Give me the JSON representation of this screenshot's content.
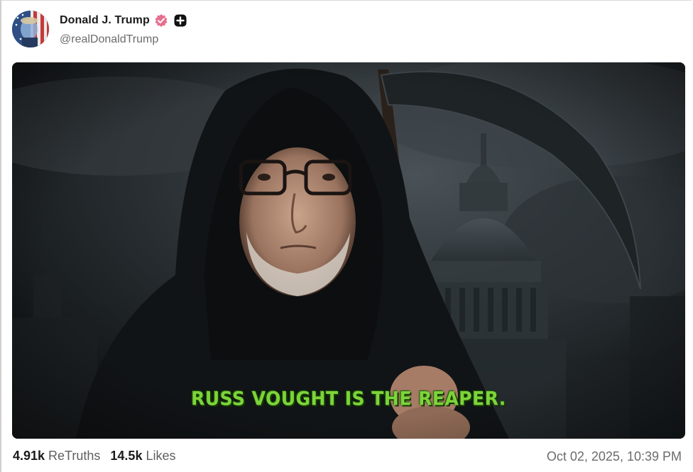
{
  "post": {
    "author_name": "Donald J. Trump",
    "handle": "@realDonaldTrump",
    "verified_color": "#e86f8f",
    "media_caption": "RUSS VOUGHT IS THE REAPER.",
    "caption_color": "#7dd43a",
    "retruths_count": "4.91k",
    "retruths_label": "ReTruths",
    "likes_count": "14.5k",
    "likes_label": "Likes",
    "timestamp": "Oct 02, 2025, 10:39 PM"
  },
  "icons": {
    "verified": "verified-badge-icon",
    "plus": "plus-badge-icon"
  }
}
